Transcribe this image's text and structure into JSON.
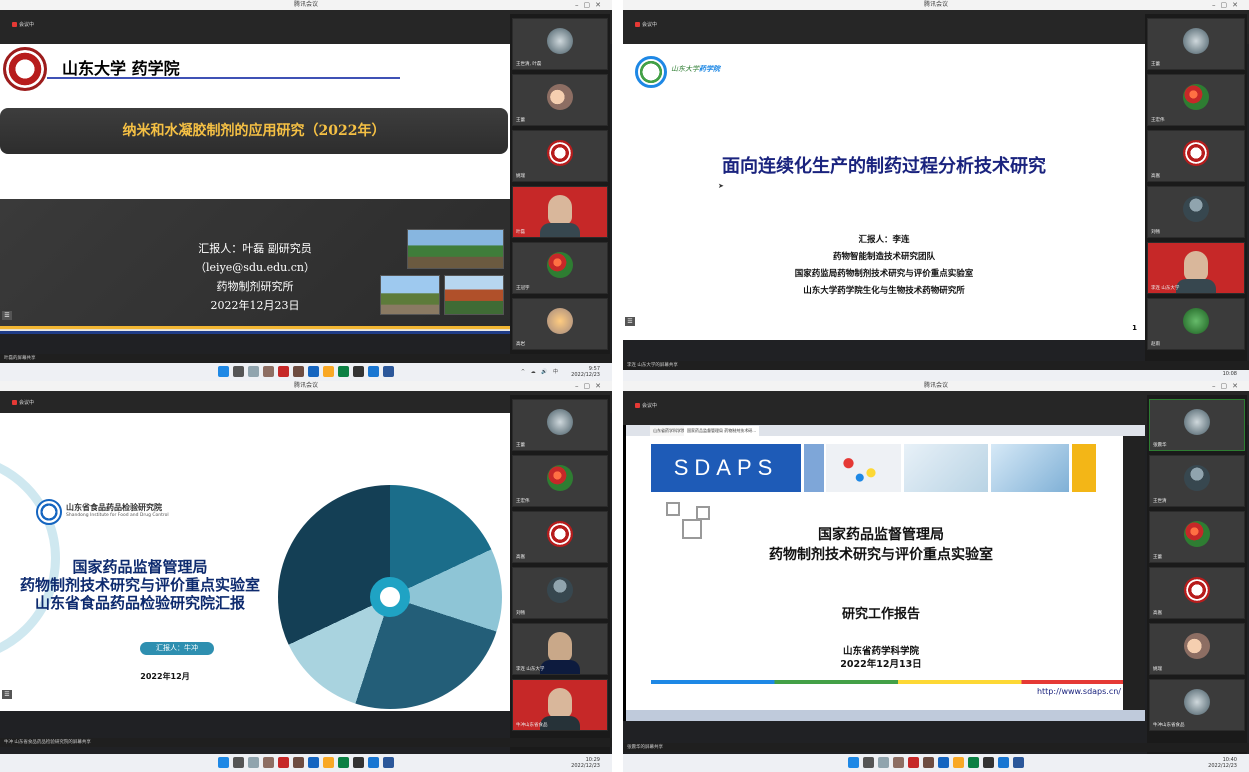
{
  "window_title": "腾讯会议",
  "meeting_label": "会议中",
  "q1": {
    "org": "山东大学 药学院",
    "title": "纳米和水凝胶制剂的应用研究（2022年）",
    "lines": [
      "汇报人：叶磊 副研究员",
      "（leiye@sdu.edu.cn）",
      "药物制剂研究所",
      "2022年12月23日"
    ],
    "status": "叶磊的屏幕共享",
    "participants": [
      "王世清, 叶磊",
      "王蕾",
      "姚瑞",
      "高嵩",
      "叶磊",
      "王冠宇",
      "高岩"
    ],
    "clock": [
      "9:57",
      "2022/12/23"
    ]
  },
  "q2": {
    "org_cn": "山东大学",
    "org_suffix": "药学院",
    "title": "面向连续化生产的制药过程分析技术研究",
    "lines": [
      "汇报人：李连",
      "药物智能制造技术研究团队",
      "国家药监局药物制剂技术研究与评价重点实验室",
      "山东大学药学院生化与生物技术药物研究所"
    ],
    "page_number": "1",
    "status": "李连 山东大学的屏幕共享",
    "participants": [
      "王世清, 张鑫, 刘东风, 杜鹃",
      "王蕾",
      "王宏伟",
      "高嵩",
      "刘畅",
      "李连 山东大学",
      "赵雨"
    ],
    "clock": [
      "10:08",
      "2022/12/23"
    ]
  },
  "q3": {
    "org": "山东省食品药品检验研究院",
    "org_en": "Shandong Institute for Food and Drug Control",
    "title": [
      "国家药品监督管理局",
      "药物制剂技术研究与评价重点实验室",
      "山东省食品药品检验研究院汇报"
    ],
    "presenter": "汇报人：牛冲",
    "date": "2022年12月",
    "status": "牛冲 山东省食品药品检验研究院的屏幕共享",
    "participants": [
      "王世清",
      "王蕾",
      "王宏伟",
      "高嵩",
      "刘畅",
      "李连 山东大学",
      "牛冲山东省食品"
    ],
    "clock": [
      "10:29",
      "2022/12/23"
    ]
  },
  "q4": {
    "banner": "SDAPS",
    "title": [
      "国家药品监督管理局",
      "药物制剂技术研究与评价重点实验室"
    ],
    "subtitle": "研究工作报告",
    "org": [
      "山东省药学科学院",
      "2022年12月13日"
    ],
    "url": "http://www.sdaps.cn/",
    "tabs": [
      "山东省药学科学院",
      "国家药品监督管理局 药物制剂技术研..."
    ],
    "status": "张震华的屏幕共享",
    "participants": [
      "张震华",
      "王世清",
      "王蕾",
      "刘畅",
      "高嵩",
      "姚瑞",
      "牛冲山东省食品"
    ],
    "clock": [
      "10:40",
      "2022/12/23"
    ]
  },
  "colors": {
    "accent_blue": "#1a237e",
    "highlight_red": "#c62828",
    "ribbon_gold": "#f2b632"
  }
}
